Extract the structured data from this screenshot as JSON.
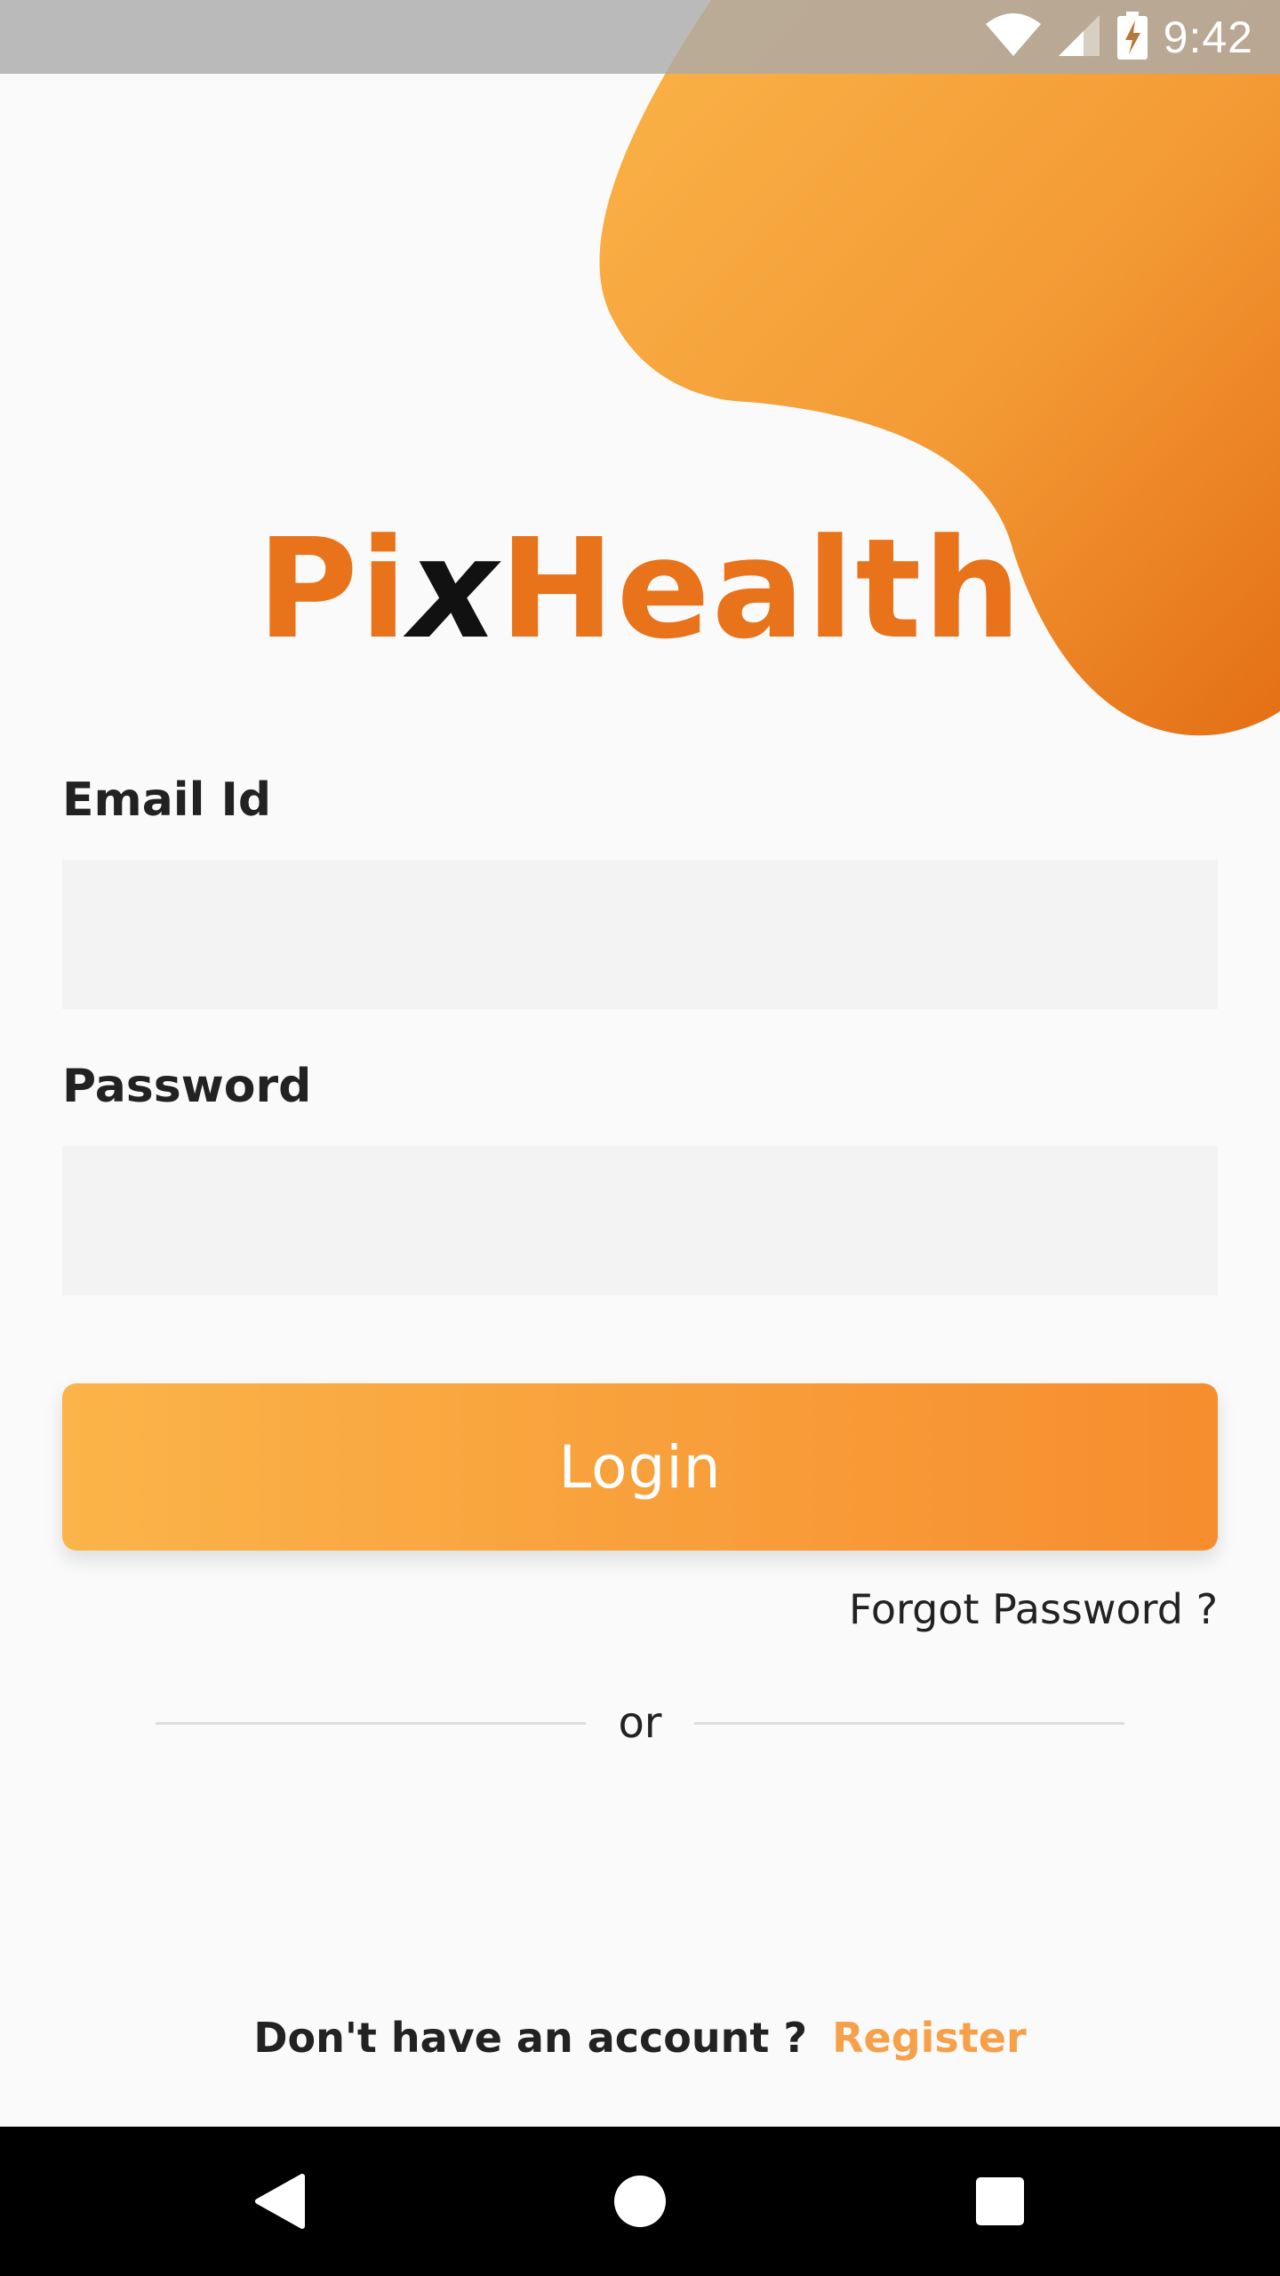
{
  "status_bar": {
    "time": "9:42",
    "icons": [
      "wifi-icon",
      "cellular-signal-icon",
      "battery-charging-icon"
    ]
  },
  "logo": {
    "part1": "Pi",
    "part2": "x",
    "part3": "Health"
  },
  "form": {
    "email_label": "Email Id",
    "email_value": "",
    "email_placeholder": "",
    "password_label": "Password",
    "password_value": "",
    "password_placeholder": "",
    "login_label": "Login",
    "forgot_label": "Forgot Password ?"
  },
  "divider": {
    "label": "or"
  },
  "footer": {
    "prompt": "Don't have an account ?",
    "register_label": "Register"
  },
  "nav_bar": {
    "icons": [
      "back-icon",
      "home-icon",
      "recents-icon"
    ]
  },
  "colors": {
    "brand_orange": "#e8731a",
    "button_gradient_start": "#fbb449",
    "button_gradient_end": "#f68d2e",
    "register_link": "#f7a04a",
    "input_background": "#f3f3f3",
    "page_background": "#fafafa"
  }
}
